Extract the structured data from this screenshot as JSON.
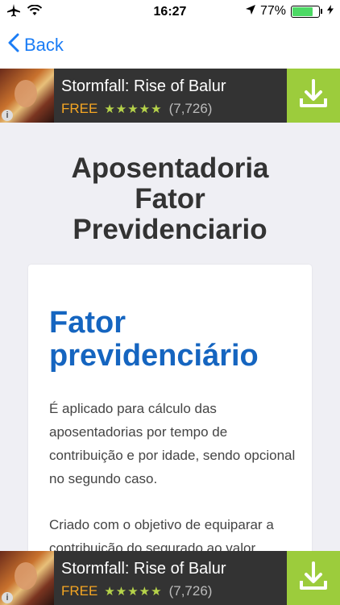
{
  "status_bar": {
    "time": "16:27",
    "battery_percent": "77%",
    "battery_level": 0.77,
    "icons": [
      "airplane-icon",
      "wifi-icon",
      "location-arrow-icon",
      "battery-icon",
      "charging-icon"
    ]
  },
  "nav": {
    "back_label": "Back"
  },
  "ad": {
    "title": "Stormfall: Rise of Balur",
    "price": "FREE",
    "rating": 4.5,
    "stars": "★★★★★",
    "count": "(7,726)",
    "info_glyph": "i",
    "accent_color": "#9ccc3c"
  },
  "page": {
    "title_line1": "Aposentadoria",
    "title_line2": "Fator",
    "title_line3": "Previdenciario"
  },
  "card": {
    "heading_line1": "Fator",
    "heading_line2": "previdenciário",
    "paragraph1": "É aplicado para cálculo das aposentadorias por tempo de contribuição e por idade, sendo opcional no segundo caso.",
    "paragraph2": "Criado com o objetivo de equiparar a contribuição do segurado ao valor"
  },
  "colors": {
    "link": "#1a7cf5",
    "heading": "#1565c0",
    "ad_bg": "#333333",
    "free": "#f5a623"
  }
}
